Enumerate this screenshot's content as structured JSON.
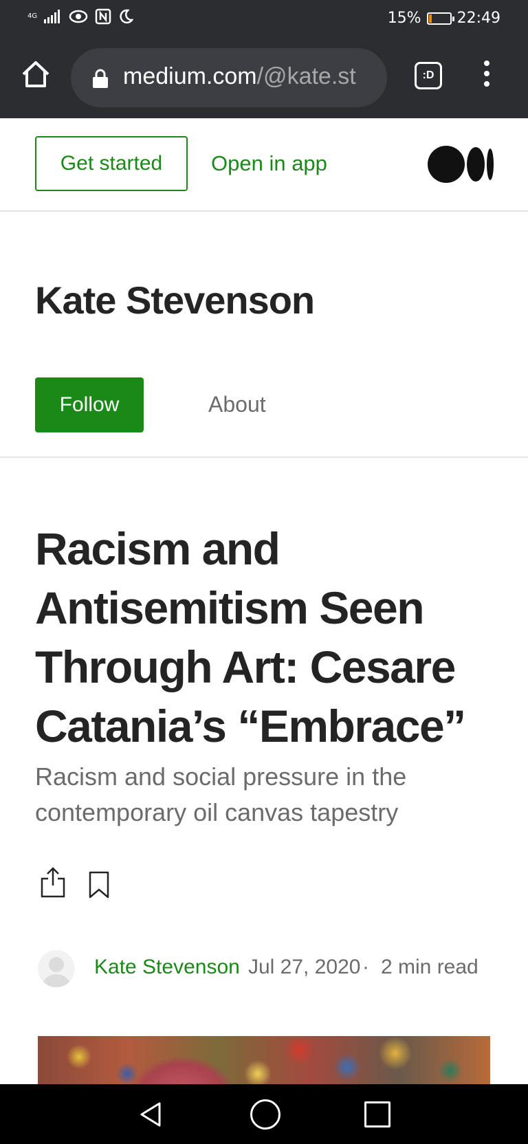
{
  "status_bar": {
    "network": "4G",
    "battery_percent": "15%",
    "battery_level": 0.15,
    "time": "22:49",
    "icons": [
      "signal-icon",
      "eye-icon",
      "nfc-icon",
      "moon-icon",
      "battery-icon"
    ]
  },
  "browser": {
    "url_host": "medium.com",
    "url_path": "/@kate.st",
    "tabs_label": ":D"
  },
  "topnav": {
    "get_started": "Get started",
    "open_in_app": "Open in app"
  },
  "profile": {
    "name": "Kate Stevenson",
    "follow_label": "Follow",
    "about_label": "About"
  },
  "article": {
    "title": "Racism and Antisemitism Seen Through Art: Cesare Catania’s “Embrace”",
    "subtitle": "Racism and social pressure in the contemporary oil canvas tapestry",
    "author": "Kate Stevenson",
    "date": "Jul 27, 2020",
    "separator": "·",
    "read_time": "2 min read"
  },
  "colors": {
    "brand_green": "#1a8917",
    "browser_bg": "#2b2d30",
    "text_primary": "#242424",
    "text_secondary": "#6b6b6b"
  }
}
